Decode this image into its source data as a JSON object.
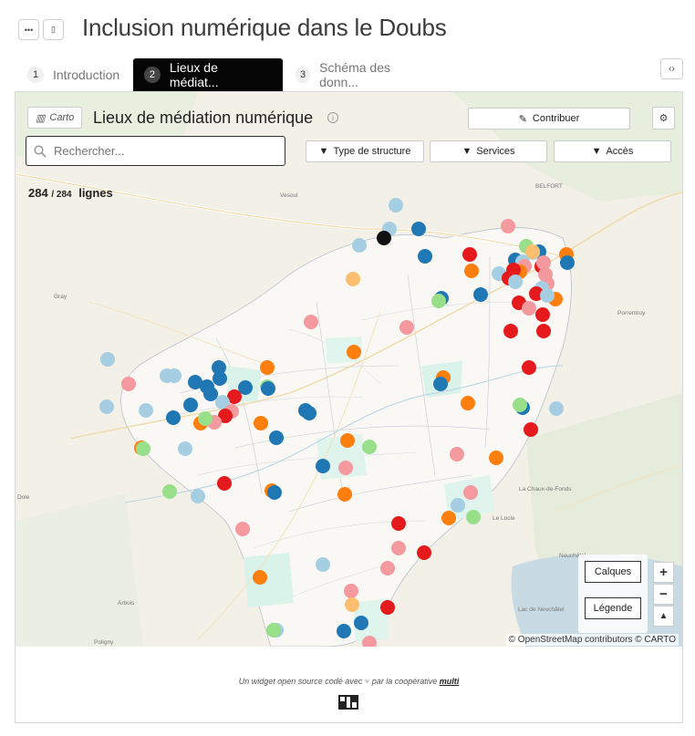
{
  "header": {
    "title": "Inclusion numérique dans le Doubs"
  },
  "tabs": [
    {
      "num": "1",
      "label": "Introduction"
    },
    {
      "num": "2",
      "label": "Lieux de médiat..."
    },
    {
      "num": "3",
      "label": "Schéma des donn..."
    }
  ],
  "map_panel": {
    "badge": "Carto",
    "title": "Lieux de médiation numérique",
    "contribute_label": "Contribuer",
    "search_placeholder": "Rechercher...",
    "filters": [
      "Type de structure",
      "Services",
      "Accès"
    ],
    "count_shown": "284",
    "count_total": "/ 284",
    "count_label": "lignes",
    "layers_label": "Calques",
    "legend_label": "Légende",
    "zoom_in": "+",
    "zoom_out": "−",
    "attribution": "© OpenStreetMap contributors © CARTO"
  },
  "places": [
    "Vesoul",
    "BELFORT",
    "Gray",
    "Porrentruy",
    "Dole",
    "La Chaux-de-Fonds",
    "Le Locle",
    "Arbois",
    "Poligny",
    "Neuchâtel",
    "Lac de Neuchâtel"
  ],
  "colors": {
    "dark_blue": "#1f77b4",
    "light_blue": "#a6cee3",
    "orange": "#ff7f0e",
    "red": "#e41a1c",
    "pink": "#f4999e",
    "green": "#98df8a",
    "peach": "#fdbf6f",
    "black": "#111111"
  },
  "footer": {
    "text": "Un widget open source codé avec",
    "text2": "par la coopérative",
    "link": "multi"
  }
}
